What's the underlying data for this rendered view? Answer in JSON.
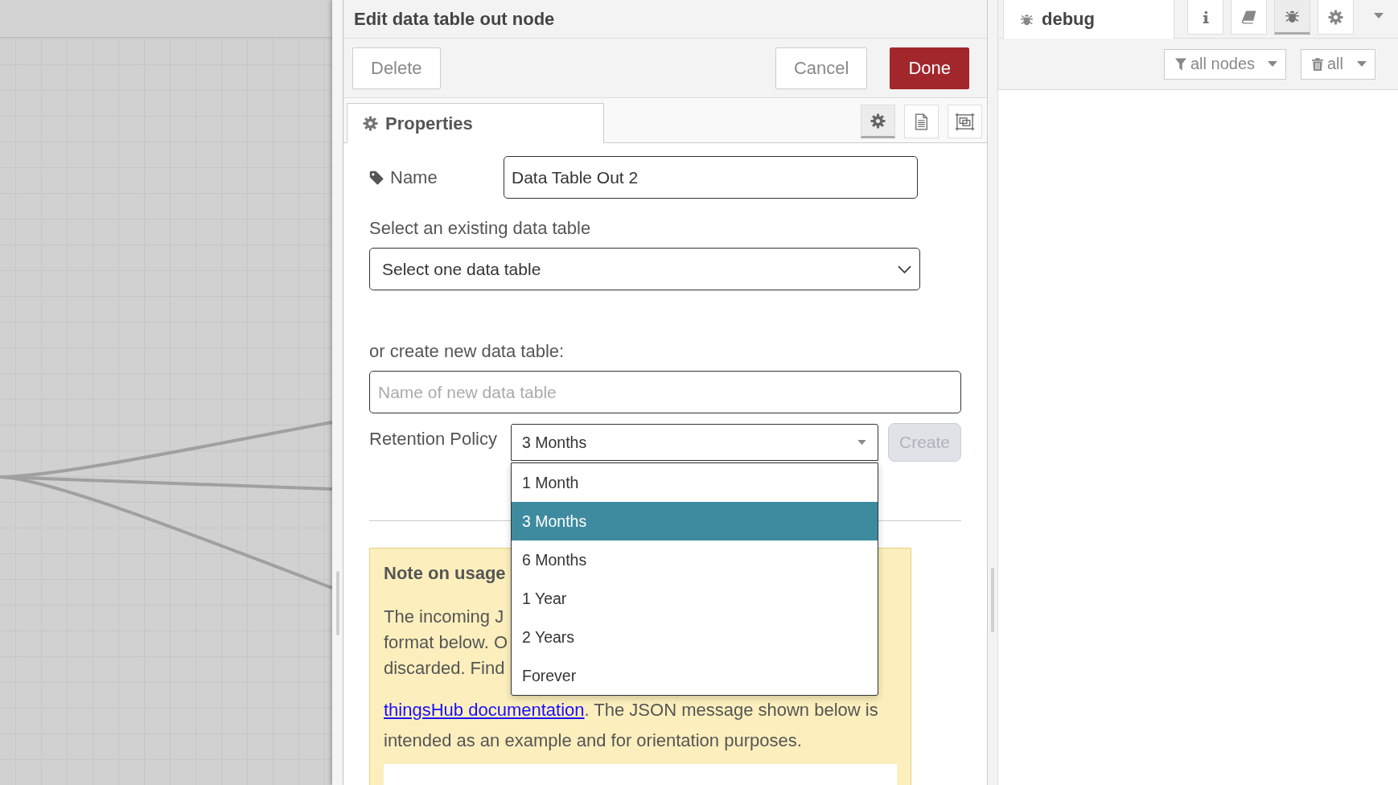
{
  "edit_tray": {
    "title": "Edit data table out node",
    "buttons": [
      {
        "label": "Delete",
        "kind": "plain"
      },
      {
        "label": "Cancel",
        "kind": "plain"
      },
      {
        "label": "Done",
        "kind": "primary"
      }
    ],
    "tabs": [
      {
        "label": "Properties",
        "selected": true
      }
    ],
    "view_buttons": [
      {
        "kind": "properties",
        "selected": true
      },
      {
        "kind": "description",
        "selected": false
      },
      {
        "kind": "appearance",
        "selected": false
      }
    ],
    "form": {
      "name": {
        "label": "Name",
        "value": "Data Table Out 2"
      },
      "existing_table": {
        "label": "Select an existing data table",
        "value": "Select one data table"
      },
      "new_table": {
        "label": "or create new data table:",
        "placeholder": "Name of new data table"
      },
      "retention": {
        "label": "Retention Policy",
        "value": "3 Months",
        "expanded": true,
        "options": [
          {
            "label": "1 Month",
            "selected": false
          },
          {
            "label": "3 Months",
            "selected": true
          },
          {
            "label": "6 Months",
            "selected": false
          },
          {
            "label": "1 Year",
            "selected": false
          },
          {
            "label": "2 Years",
            "selected": false
          },
          {
            "label": "Forever",
            "selected": false
          }
        ]
      },
      "create_button": {
        "label": "Create",
        "disabled": true
      }
    },
    "note": {
      "title": "Note on usage",
      "lines": [
        "The incoming J",
        "format below. O",
        "discarded. Find"
      ],
      "link": "thingsHub documentation",
      "link_tail": ". The JSON message shown below is",
      "last_line": "intended as an example and for orientation purposes."
    }
  },
  "sidebar": {
    "tabs": [
      {
        "label": "debug",
        "selected": true
      }
    ],
    "tab_buttons": [
      {
        "kind": "info",
        "selected": false
      },
      {
        "kind": "help",
        "selected": false
      },
      {
        "kind": "debug",
        "selected": true
      },
      {
        "kind": "config",
        "selected": false
      }
    ],
    "filter_button": {
      "label": "all nodes"
    },
    "clear_button": {
      "label": "all"
    }
  }
}
